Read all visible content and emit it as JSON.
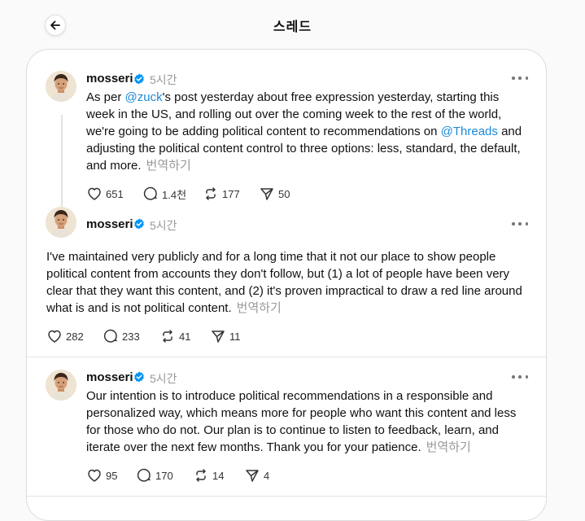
{
  "header": {
    "title": "스레드"
  },
  "colors": {
    "accent": "#1d8ad6",
    "verified": "#0095f6",
    "muted": "#999999"
  },
  "posts": [
    {
      "username": "mosseri",
      "time": "5시간",
      "body_segments": [
        "As per ",
        "@zuck",
        "'s post yesterday about free expression yesterday, starting this week in the US, and rolling out over the coming week to the rest of the world, we're going to be adding political content to recommendations on ",
        "@Threads",
        " and adjusting the political content control to three options: less, standard, the default, and more."
      ],
      "translate": "번역하기",
      "likes": "651",
      "replies": "1.4천",
      "reposts": "177",
      "shares": "50"
    },
    {
      "username": "mosseri",
      "time": "5시간",
      "body": "I've maintained very publicly and for a long time that it not our place to show people political content from accounts they don't follow, but (1) a lot of people have been very clear that they want this content, and (2) it's proven impractical to draw a red line around what is and is not political content.",
      "translate": "번역하기",
      "likes": "282",
      "replies": "233",
      "reposts": "41",
      "shares": "11"
    },
    {
      "username": "mosseri",
      "time": "5시간",
      "body": "Our intention is to introduce political recommendations in a responsible and personalized way, which means more for people who want this content and less for those who do not. Our plan is to continue to listen to feedback, learn, and iterate over the next few months. Thank you for your patience.",
      "translate": "번역하기",
      "likes": "95",
      "replies": "170",
      "reposts": "14",
      "shares": "4"
    }
  ]
}
